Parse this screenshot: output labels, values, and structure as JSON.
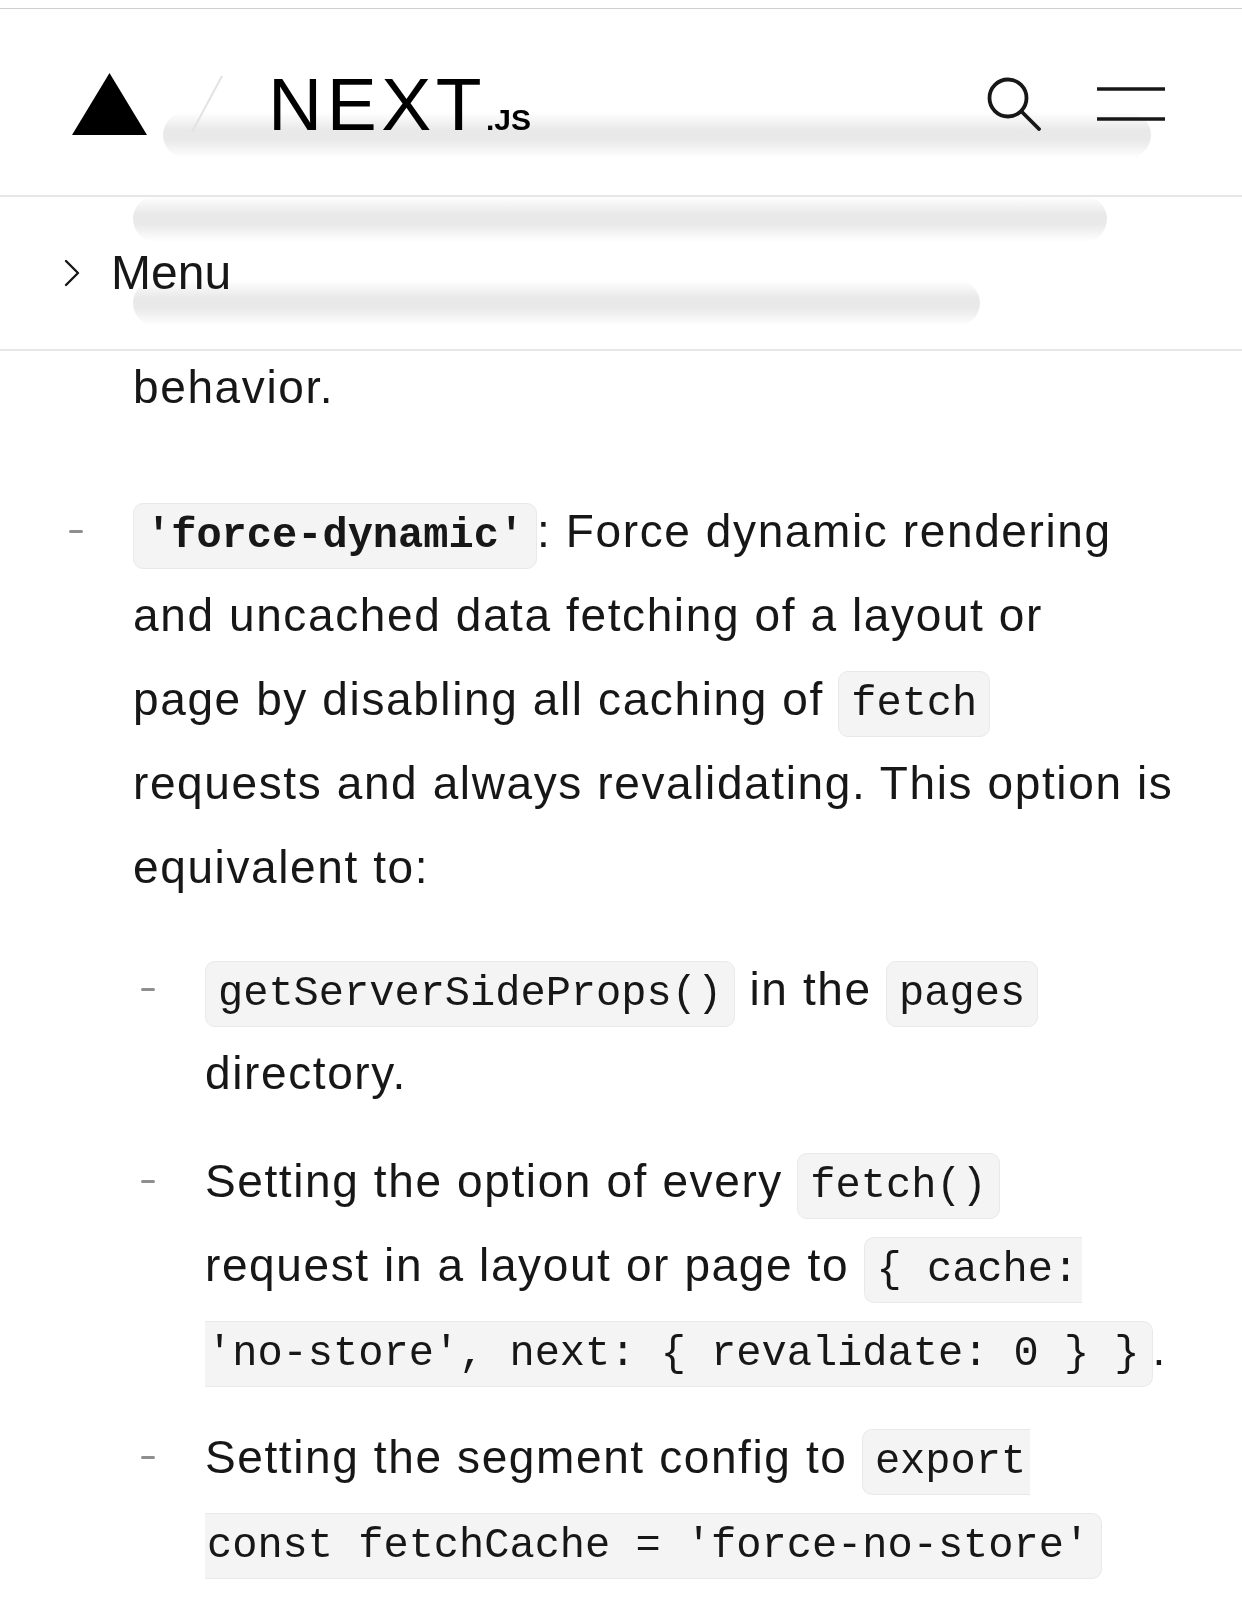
{
  "header": {
    "logo_wordmark": "NEXT",
    "logo_suffix": ".JS"
  },
  "menu_bar": {
    "label": "Menu",
    "expanded": false
  },
  "content": {
    "paragraph_tail": "behavior.",
    "list": [
      {
        "lines": [
          [
            {
              "kind": "code",
              "text": "'force-dynamic'",
              "bold": true,
              "split_before": false,
              "split_after": false
            },
            {
              "kind": "text",
              "text": ": Force dynamic rendering"
            }
          ],
          [
            {
              "kind": "text",
              "text": "and uncached data fetching of a layout or"
            }
          ],
          [
            {
              "kind": "text",
              "text": "page by disabling all caching of "
            },
            {
              "kind": "code",
              "text": "fetch",
              "bold": false,
              "split_before": false,
              "split_after": false
            }
          ],
          [
            {
              "kind": "text",
              "text": "requests and always revalidating. This option is"
            }
          ],
          [
            {
              "kind": "text",
              "text": "equivalent to:"
            }
          ]
        ],
        "children": [
          {
            "lines": [
              [
                {
                  "kind": "code",
                  "text": "getServerSideProps()",
                  "bold": false,
                  "split_before": false,
                  "split_after": false
                },
                {
                  "kind": "text",
                  "text": " in the "
                },
                {
                  "kind": "code",
                  "text": "pages",
                  "bold": false,
                  "split_before": false,
                  "split_after": false
                }
              ],
              [
                {
                  "kind": "text",
                  "text": "directory."
                }
              ]
            ]
          },
          {
            "lines": [
              [
                {
                  "kind": "text",
                  "text": "Setting the option of every "
                },
                {
                  "kind": "code",
                  "text": "fetch()",
                  "bold": false,
                  "split_before": false,
                  "split_after": false
                }
              ],
              [
                {
                  "kind": "text",
                  "text": "request in a layout or page to "
                },
                {
                  "kind": "code",
                  "text": "{ cache:",
                  "bold": false,
                  "split_before": false,
                  "split_after": true
                }
              ],
              [
                {
                  "kind": "code",
                  "text": "'no-store', next: { revalidate: 0 } }",
                  "bold": false,
                  "split_before": true,
                  "split_after": false
                },
                {
                  "kind": "text",
                  "text": "."
                }
              ]
            ]
          },
          {
            "lines": [
              [
                {
                  "kind": "text",
                  "text": "Setting the segment config to "
                },
                {
                  "kind": "code",
                  "text": "export",
                  "bold": false,
                  "split_before": false,
                  "split_after": true
                }
              ],
              [
                {
                  "kind": "code",
                  "text": "const fetchCache = 'force-no-store'",
                  "bold": false,
                  "split_before": true,
                  "split_after": false
                }
              ]
            ]
          }
        ]
      }
    ]
  }
}
